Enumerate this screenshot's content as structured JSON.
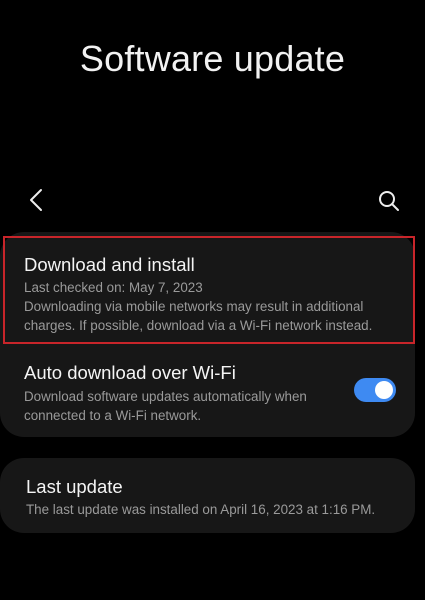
{
  "header": {
    "title": "Software update"
  },
  "toolbar": {
    "back_icon": "chevron-left-icon",
    "search_icon": "search-icon"
  },
  "settings": {
    "download_install": {
      "title": "Download and install",
      "last_checked": "Last checked on: May 7, 2023",
      "note": "Downloading via mobile networks may result in additional charges. If possible, download via a Wi-Fi network instead.",
      "highlight_color": "#c8252a"
    },
    "auto_download": {
      "title": "Auto download over Wi-Fi",
      "description": "Download software updates automatically when connected to a Wi-Fi network.",
      "enabled": true,
      "toggle_color": "#3e8af2"
    },
    "last_update": {
      "title": "Last update",
      "description": "The last update was installed on April 16, 2023 at 1:16 PM."
    }
  }
}
